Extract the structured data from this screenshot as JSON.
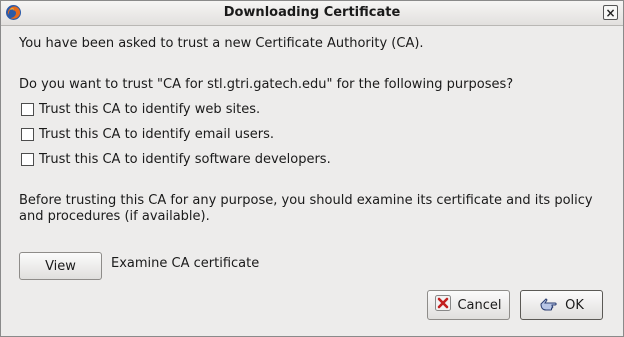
{
  "window": {
    "title": "Downloading Certificate",
    "close_glyph": "×"
  },
  "body": {
    "intro": "You have been asked to trust a new Certificate Authority (CA).",
    "question": "Do you want to trust \"CA for stl.gtri.gatech.edu\" for the following purposes?",
    "purposes": [
      {
        "label": "Trust this CA to identify web sites.",
        "checked": false
      },
      {
        "label": "Trust this CA to identify email users.",
        "checked": false
      },
      {
        "label": "Trust this CA to identify software developers.",
        "checked": false
      }
    ],
    "advice": "Before trusting this CA for any purpose, you should examine its certificate and its policy and procedures (if available).",
    "view_button": "View",
    "view_caption": "Examine CA certificate"
  },
  "buttons": {
    "cancel": "Cancel",
    "ok": "OK"
  },
  "icons": {
    "app": "firefox-icon",
    "cancel": "cancel-x-icon",
    "ok": "ok-hand-icon",
    "close": "close-icon"
  }
}
